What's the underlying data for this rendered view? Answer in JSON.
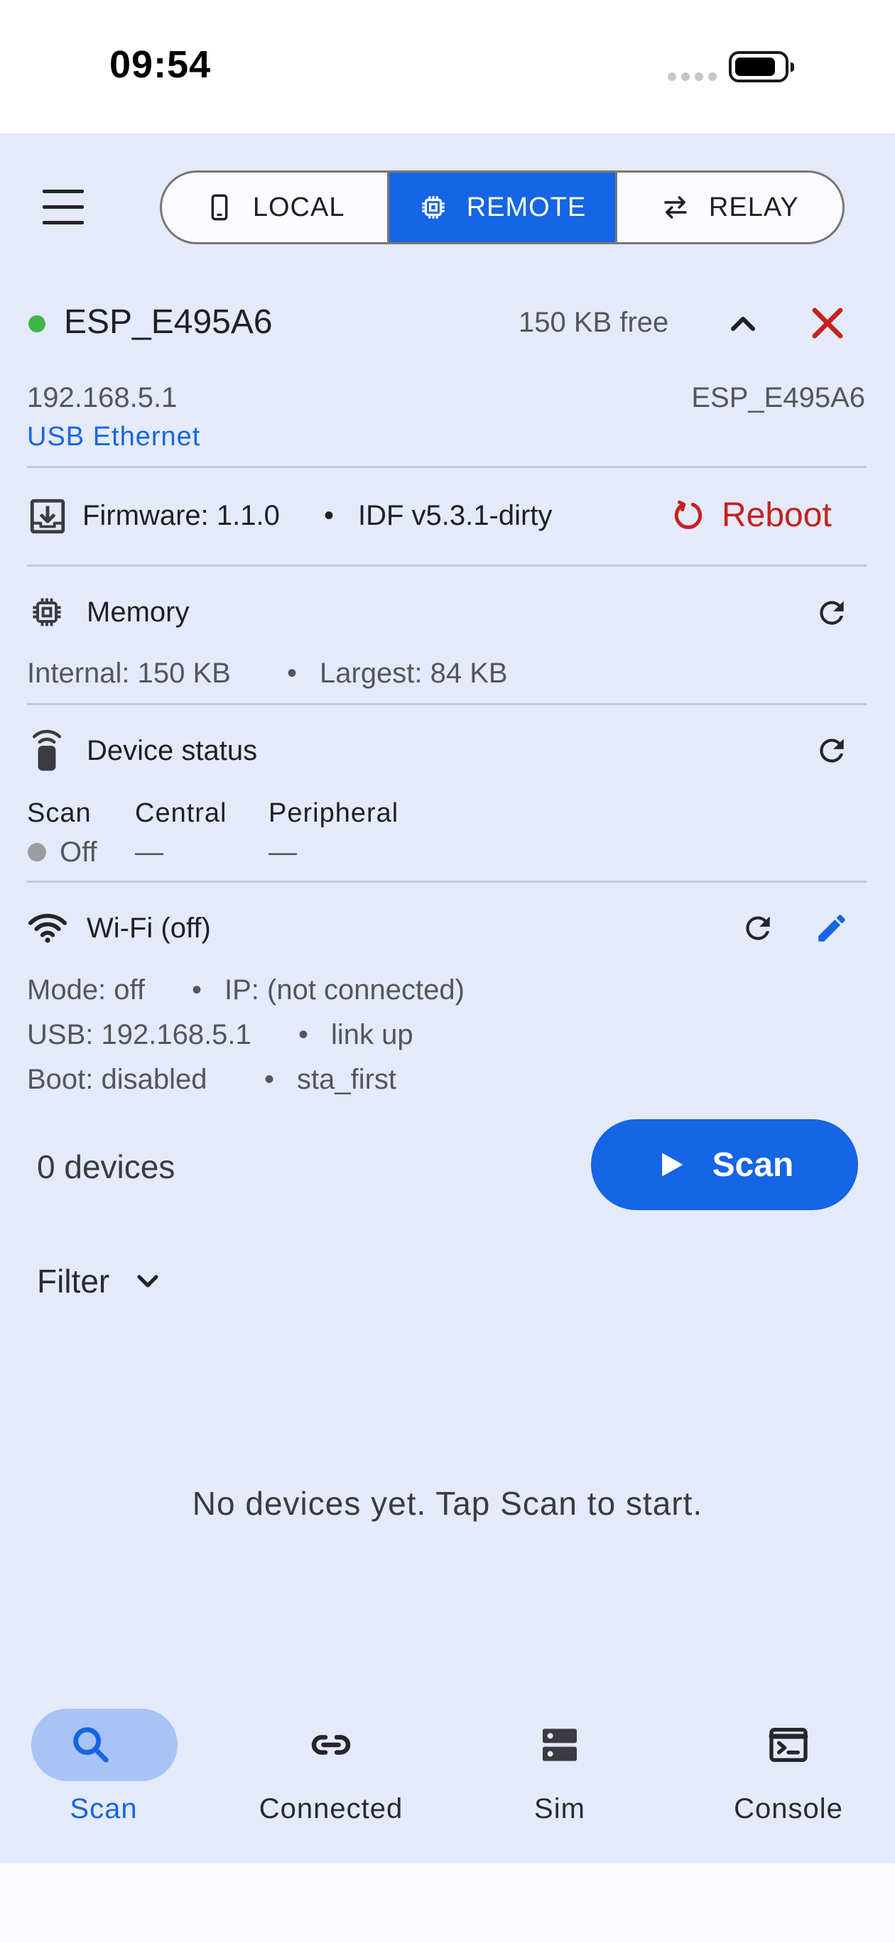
{
  "status_bar": {
    "time": "09:54"
  },
  "modes": [
    {
      "label": "LOCAL",
      "icon": "phone-icon",
      "active": false
    },
    {
      "label": "REMOTE",
      "icon": "chip-icon",
      "active": true
    },
    {
      "label": "RELAY",
      "icon": "swap-arrows-icon",
      "active": false
    }
  ],
  "device": {
    "name": "ESP_E495A6",
    "free": "150 KB free",
    "ip": "192.168.5.1",
    "hostname": "ESP_E495A6",
    "transport": "USB Ethernet"
  },
  "firmware": {
    "version": "Firmware: 1.1.0",
    "idf": "IDF v5.3.1-dirty",
    "reboot_label": "Reboot",
    "separator": "•"
  },
  "memory": {
    "title": "Memory",
    "internal": "Internal: 150 KB",
    "largest": "Largest: 84 KB"
  },
  "device_status": {
    "title": "Device status",
    "scan_label": "Scan",
    "central_label": "Central",
    "peripheral_label": "Peripheral",
    "scan_value": "Off",
    "central_value": "—",
    "peripheral_value": "—"
  },
  "wifi": {
    "title": "Wi-Fi (off)",
    "mode": "Mode: off",
    "ip": "IP: (not connected)",
    "usb": "USB: 192.168.5.1",
    "link": "link up",
    "boot": "Boot: disabled",
    "boot_mode": "sta_first"
  },
  "scan": {
    "count": "0 devices",
    "button_label": "Scan",
    "filter_label": "Filter",
    "empty_message": "No devices yet. Tap Scan to start."
  },
  "bottom_nav": [
    {
      "label": "Scan",
      "icon": "search-icon",
      "active": true
    },
    {
      "label": "Connected",
      "icon": "link-icon",
      "active": false
    },
    {
      "label": "Sim",
      "icon": "storage-icon",
      "active": false
    },
    {
      "label": "Console",
      "icon": "terminal-icon",
      "active": false
    }
  ],
  "colors": {
    "accent": "#1565e4",
    "background": "#e4eafa",
    "danger": "#c5221f",
    "online": "#3fb44a",
    "nav_active_pill": "#a9c3f6"
  }
}
